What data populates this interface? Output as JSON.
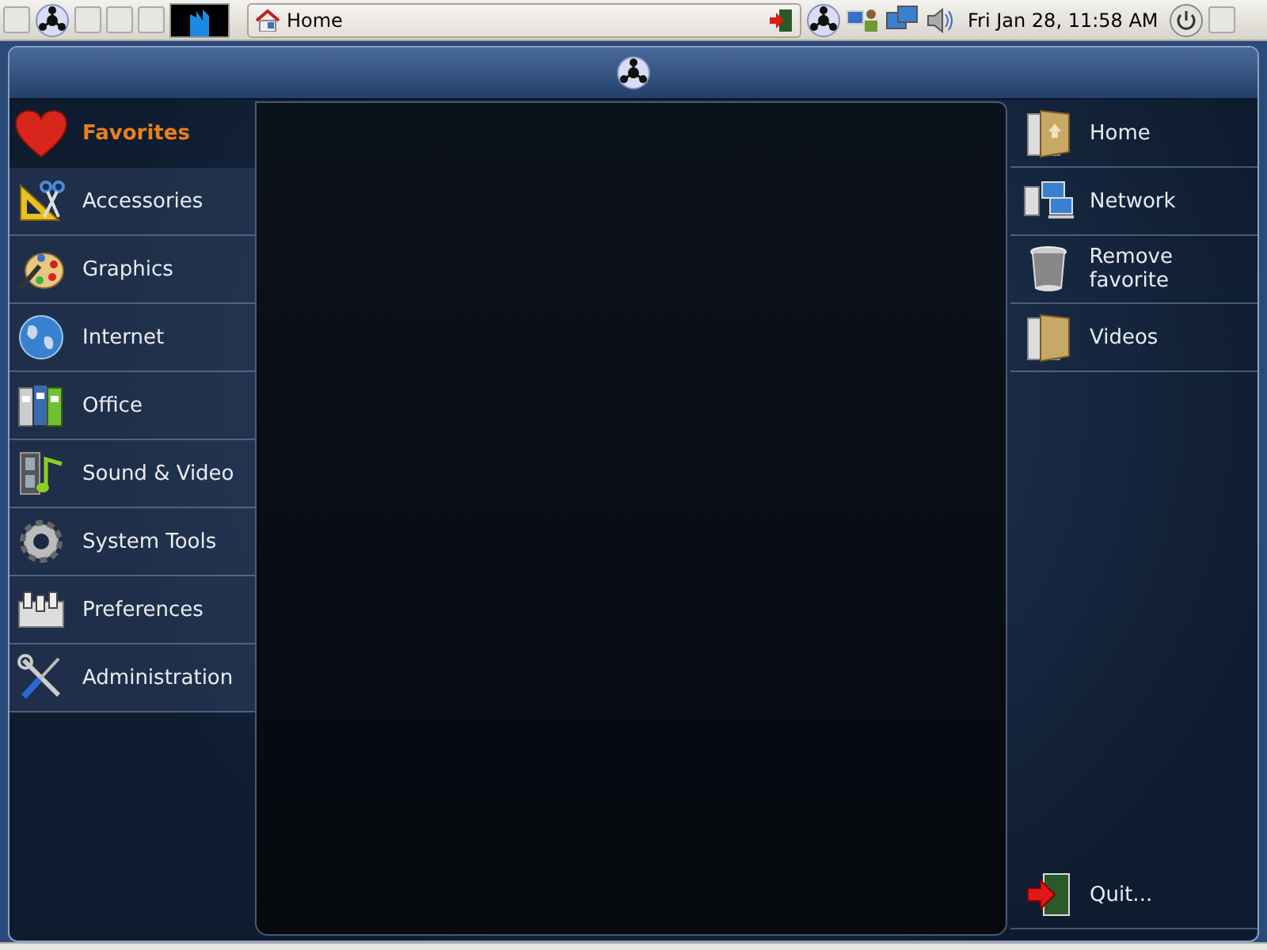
{
  "top_panel": {
    "task_button": {
      "label": "Home"
    },
    "clock": "Fri Jan 28, 11:58 AM"
  },
  "categories": [
    {
      "label": "Favorites",
      "selected": true
    },
    {
      "label": "Accessories",
      "selected": false
    },
    {
      "label": "Graphics",
      "selected": false
    },
    {
      "label": "Internet",
      "selected": false
    },
    {
      "label": "Office",
      "selected": false
    },
    {
      "label": "Sound & Video",
      "selected": false
    },
    {
      "label": "System Tools",
      "selected": false
    },
    {
      "label": "Preferences",
      "selected": false
    },
    {
      "label": "Administration",
      "selected": false
    }
  ],
  "places": [
    {
      "label": "Home"
    },
    {
      "label": "Network"
    },
    {
      "label": "Remove favorite"
    },
    {
      "label": "Videos"
    }
  ],
  "quit": {
    "label": "Quit..."
  }
}
